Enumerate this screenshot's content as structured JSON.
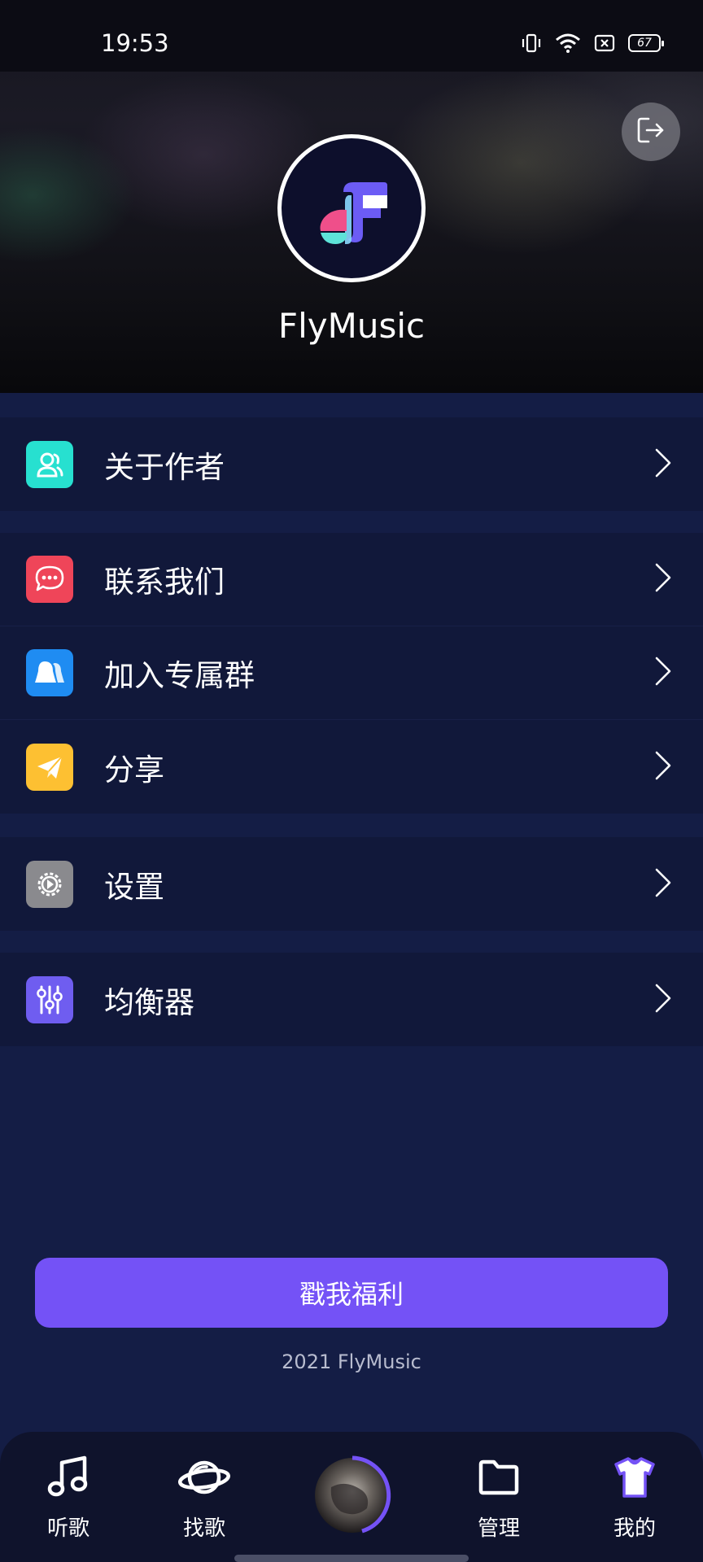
{
  "status_bar": {
    "time": "19:53",
    "battery": "67"
  },
  "header": {
    "app_name": "FlyMusic",
    "logout_icon": "logout-icon"
  },
  "menu": {
    "group1": [
      {
        "label": "关于作者",
        "icon": "author-icon",
        "color": "#27e0d0"
      }
    ],
    "group2": [
      {
        "label": "联系我们",
        "icon": "chat-icon",
        "color": "#ef4559"
      },
      {
        "label": "加入专属群",
        "icon": "group-icon",
        "color": "#1f8cf2"
      },
      {
        "label": "分享",
        "icon": "share-icon",
        "color": "#fdc032"
      }
    ],
    "group3": [
      {
        "label": "设置",
        "icon": "settings-icon",
        "color": "#8a8a8e"
      }
    ],
    "group4": [
      {
        "label": "均衡器",
        "icon": "equalizer-icon",
        "color": "#6f5df0"
      }
    ]
  },
  "welfare_button": "戳我福利",
  "copyright": "2021 FlyMusic",
  "bottom_nav": {
    "items": [
      {
        "label": "听歌",
        "icon": "music-note-icon"
      },
      {
        "label": "找歌",
        "icon": "planet-icon"
      },
      {
        "label": "管理",
        "icon": "folder-icon"
      },
      {
        "label": "我的",
        "icon": "shirt-icon"
      }
    ],
    "accent": "#7452f6"
  }
}
